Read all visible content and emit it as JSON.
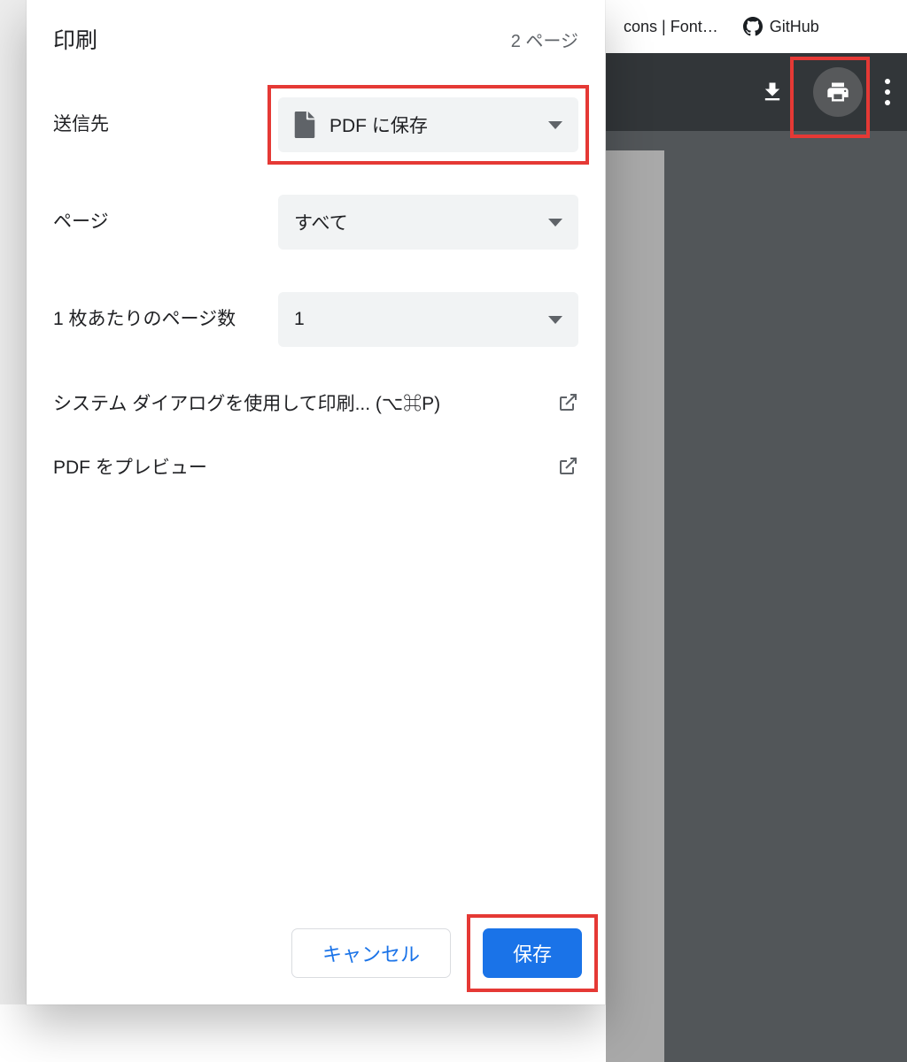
{
  "browser": {
    "tab_partial": "cons | Font…",
    "github_label": "GitHub"
  },
  "dialog": {
    "title": "印刷",
    "page_count": "2 ページ",
    "fields": {
      "destination": {
        "label": "送信先",
        "value": "PDF に保存"
      },
      "pages": {
        "label": "ページ",
        "value": "すべて"
      },
      "pages_per_sheet": {
        "label": "1 枚あたりのページ数",
        "value": "1"
      }
    },
    "links": {
      "system_dialog": "システム ダイアログを使用して印刷... (⌥⌘P)",
      "preview_pdf": "PDF をプレビュー"
    },
    "buttons": {
      "cancel": "キャンセル",
      "save": "保存"
    }
  }
}
